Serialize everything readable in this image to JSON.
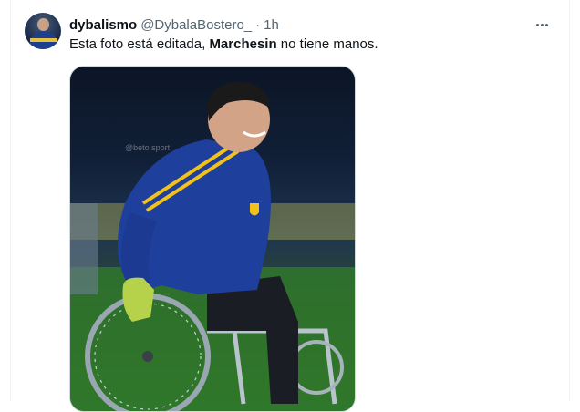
{
  "tweet": {
    "display_name": "dybalismo",
    "handle": "@DybalaBostero_",
    "separator": "·",
    "time": "1h",
    "text_before": "Esta foto está editada, ",
    "text_bold": "Marchesin",
    "text_after": " no tiene manos.",
    "more_icon": "more-horizontal-icon",
    "media_watermark": "@beto sport"
  },
  "colors": {
    "primary_text": "#0f1419",
    "secondary_text": "#536471",
    "border": "#cfd9de",
    "jersey_blue": "#1f3f9c",
    "jersey_yellow": "#f2c21b"
  }
}
